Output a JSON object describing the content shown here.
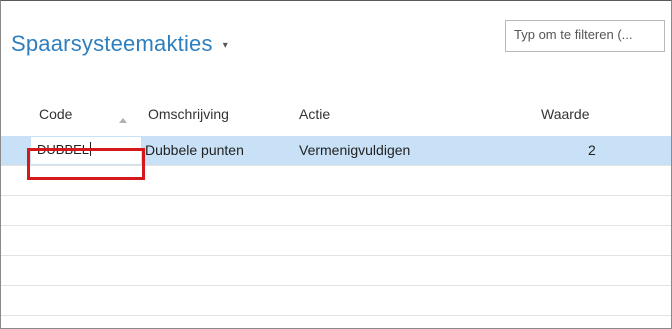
{
  "header": {
    "title": "Spaarsysteemakties",
    "title_caret": "▾",
    "search_placeholder": "Typ om te filteren (..."
  },
  "table": {
    "columns": [
      "Code",
      "Omschrijving",
      "Actie",
      "Waarde"
    ],
    "sort_column": "Code",
    "rows": [
      {
        "code": "DUBBEL",
        "omschrijving": "Dubbele punten",
        "actie": "Vermenigvuldigen",
        "waarde": "2"
      }
    ]
  },
  "highlight_color": "#d4191d",
  "accent_color": "#2f7fbf",
  "selected_row_color": "#c8e1f6"
}
